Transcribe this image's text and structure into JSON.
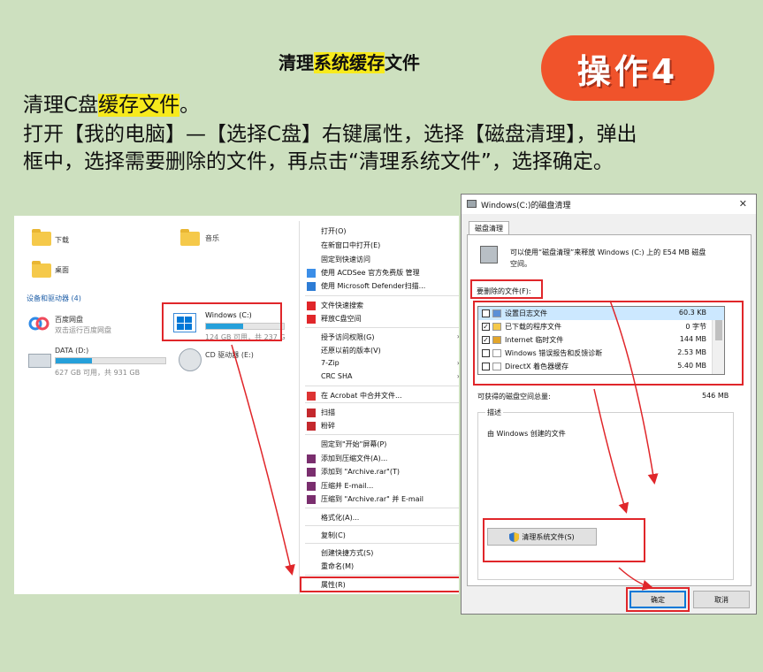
{
  "header": {
    "title_pre": "清理",
    "title_hl": "系统缓存",
    "title_post": "文件",
    "badge": "操作4",
    "line1_pre": "清理C盘",
    "line1_hl": "缓存文件",
    "line1_post": "。",
    "line2": "打开【我的电脑】—【选择C盘】右键属性，选择【磁盘清理】，弹出",
    "line3": "框中，选择需要删除的文件，再点击“清理系统文件”，选择确定。"
  },
  "explorer": {
    "folders": [
      "下载",
      "音乐",
      "桌面"
    ],
    "section_title": "设备和驱动器 (4)",
    "baidu_name": "百度网盘",
    "baidu_sub": "双击运行百度网盘",
    "drive_c_name": "Windows (C:)",
    "drive_c_info": "124 GB 可用，共 237 G",
    "drive_c_fill": 0.48,
    "drive_d_name": "DATA (D:)",
    "drive_d_info": "627 GB 可用，共 931 GB",
    "drive_d_fill": 0.33,
    "cd_name": "CD 驱动器 (E:)"
  },
  "context_menu": {
    "items": [
      "打开(O)",
      "在新窗口中打开(E)",
      "固定到快速访问",
      "使用 ACDSee 官方免费版 管理",
      "使用 Microsoft Defender扫描...",
      "文件快速搜索",
      "释放C盘空间",
      "授予访问权限(G)",
      "还原以前的版本(V)",
      "7-Zip",
      "CRC SHA",
      "在 Acrobat 中合并文件...",
      "扫描",
      "粉碎",
      "固定到\"开始\"屏幕(P)",
      "添加到压缩文件(A)...",
      "添加到 \"Archive.rar\"(T)",
      "压缩并 E-mail...",
      "压缩到 \"Archive.rar\" 并 E-mail",
      "格式化(A)...",
      "复制(C)",
      "创建快捷方式(S)",
      "重命名(M)",
      "属性(R)"
    ]
  },
  "dialog": {
    "title": "Windows(C:)的磁盘清理",
    "close": "✕",
    "tab": "磁盘清理",
    "desc_line1": "可以使用“磁盘清理”来释放 Windows (C:) 上的 E54 MB 磁盘",
    "desc_line2": "空间。",
    "files_label": "要删除的文件(F):",
    "files": [
      {
        "name": "设置日志文件",
        "size": "60.3 KB",
        "checked": "",
        "color": "#5b8fd6"
      },
      {
        "name": "已下载的程序文件",
        "size": "0 字节",
        "checked": "✓",
        "color": "#f5c94a"
      },
      {
        "name": "Internet 临时文件",
        "size": "144 MB",
        "checked": "✓",
        "color": "#e2a52b"
      },
      {
        "name": "Windows 错误报告和反馈诊断",
        "size": "2.53 MB",
        "checked": "",
        "color": "#ffffff"
      },
      {
        "name": "DirectX 着色器缓存",
        "size": "5.40 MB",
        "checked": "",
        "color": "#ffffff"
      }
    ],
    "space_label": "可获得的磁盘空间总量:",
    "space_value": "546 MB",
    "desc_legend": "描述",
    "desc_text": "由 Windows 创建的文件",
    "clean_btn": "清理系统文件(S)",
    "ok": "确定",
    "cancel": "取消"
  },
  "colors": {
    "bg": "#cde0bf",
    "badge": "#f0532b",
    "highlight": "#f7ea1c",
    "annotation": "#e0262a"
  }
}
